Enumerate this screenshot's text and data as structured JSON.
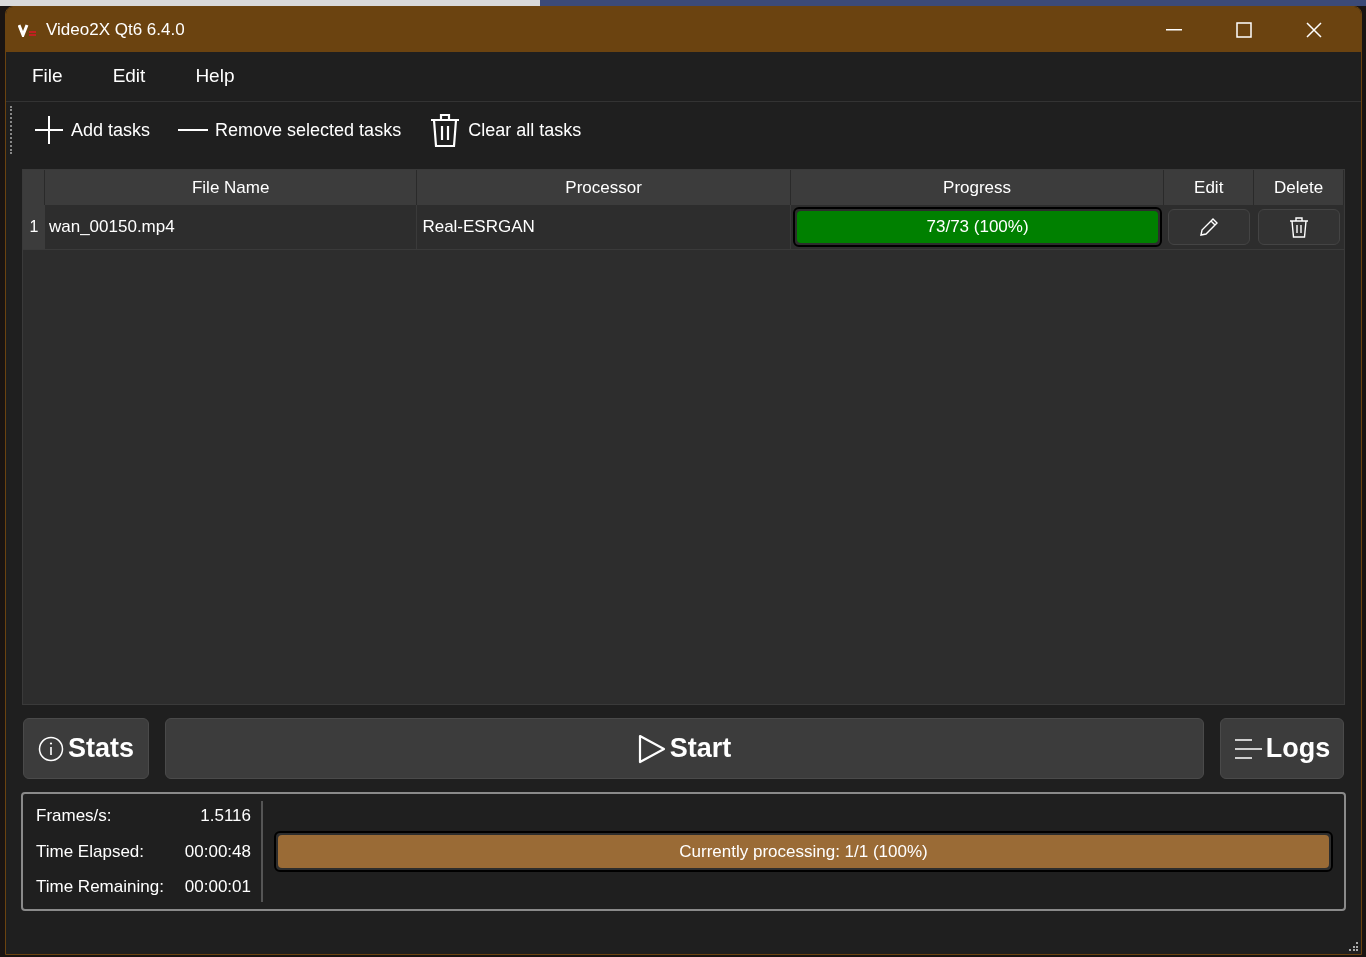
{
  "window": {
    "title": "Video2X Qt6 6.4.0"
  },
  "menu": [
    "File",
    "Edit",
    "Help"
  ],
  "toolbar": [
    {
      "kind": "add",
      "label": "Add tasks"
    },
    {
      "kind": "remove",
      "label": "Remove selected tasks"
    },
    {
      "kind": "clear",
      "label": "Clear all tasks"
    }
  ],
  "table": {
    "columns": [
      "File Name",
      "Processor",
      "Progress",
      "Edit",
      "Delete"
    ],
    "rows": [
      {
        "number": "1",
        "file_name": "wan_00150.mp4",
        "processor": "Real-ESRGAN",
        "progress": {
          "level": 1,
          "text": "73/73 (100%)"
        }
      }
    ]
  },
  "buttons": [
    {
      "kind": "stats",
      "label": "Stats"
    },
    {
      "kind": "start",
      "label": "Start"
    },
    {
      "kind": "logs",
      "label": "Logs"
    }
  ],
  "stats": [
    {
      "label": "Frames/s:",
      "value": "1.5116"
    },
    {
      "label": "Time Elapsed:",
      "value": "00:00:48"
    },
    {
      "label": "Time Remaining:",
      "value": "00:00:01"
    }
  ],
  "overall_progress": {
    "level": 1,
    "text": "Currently processing: 1/1 (100%)"
  }
}
